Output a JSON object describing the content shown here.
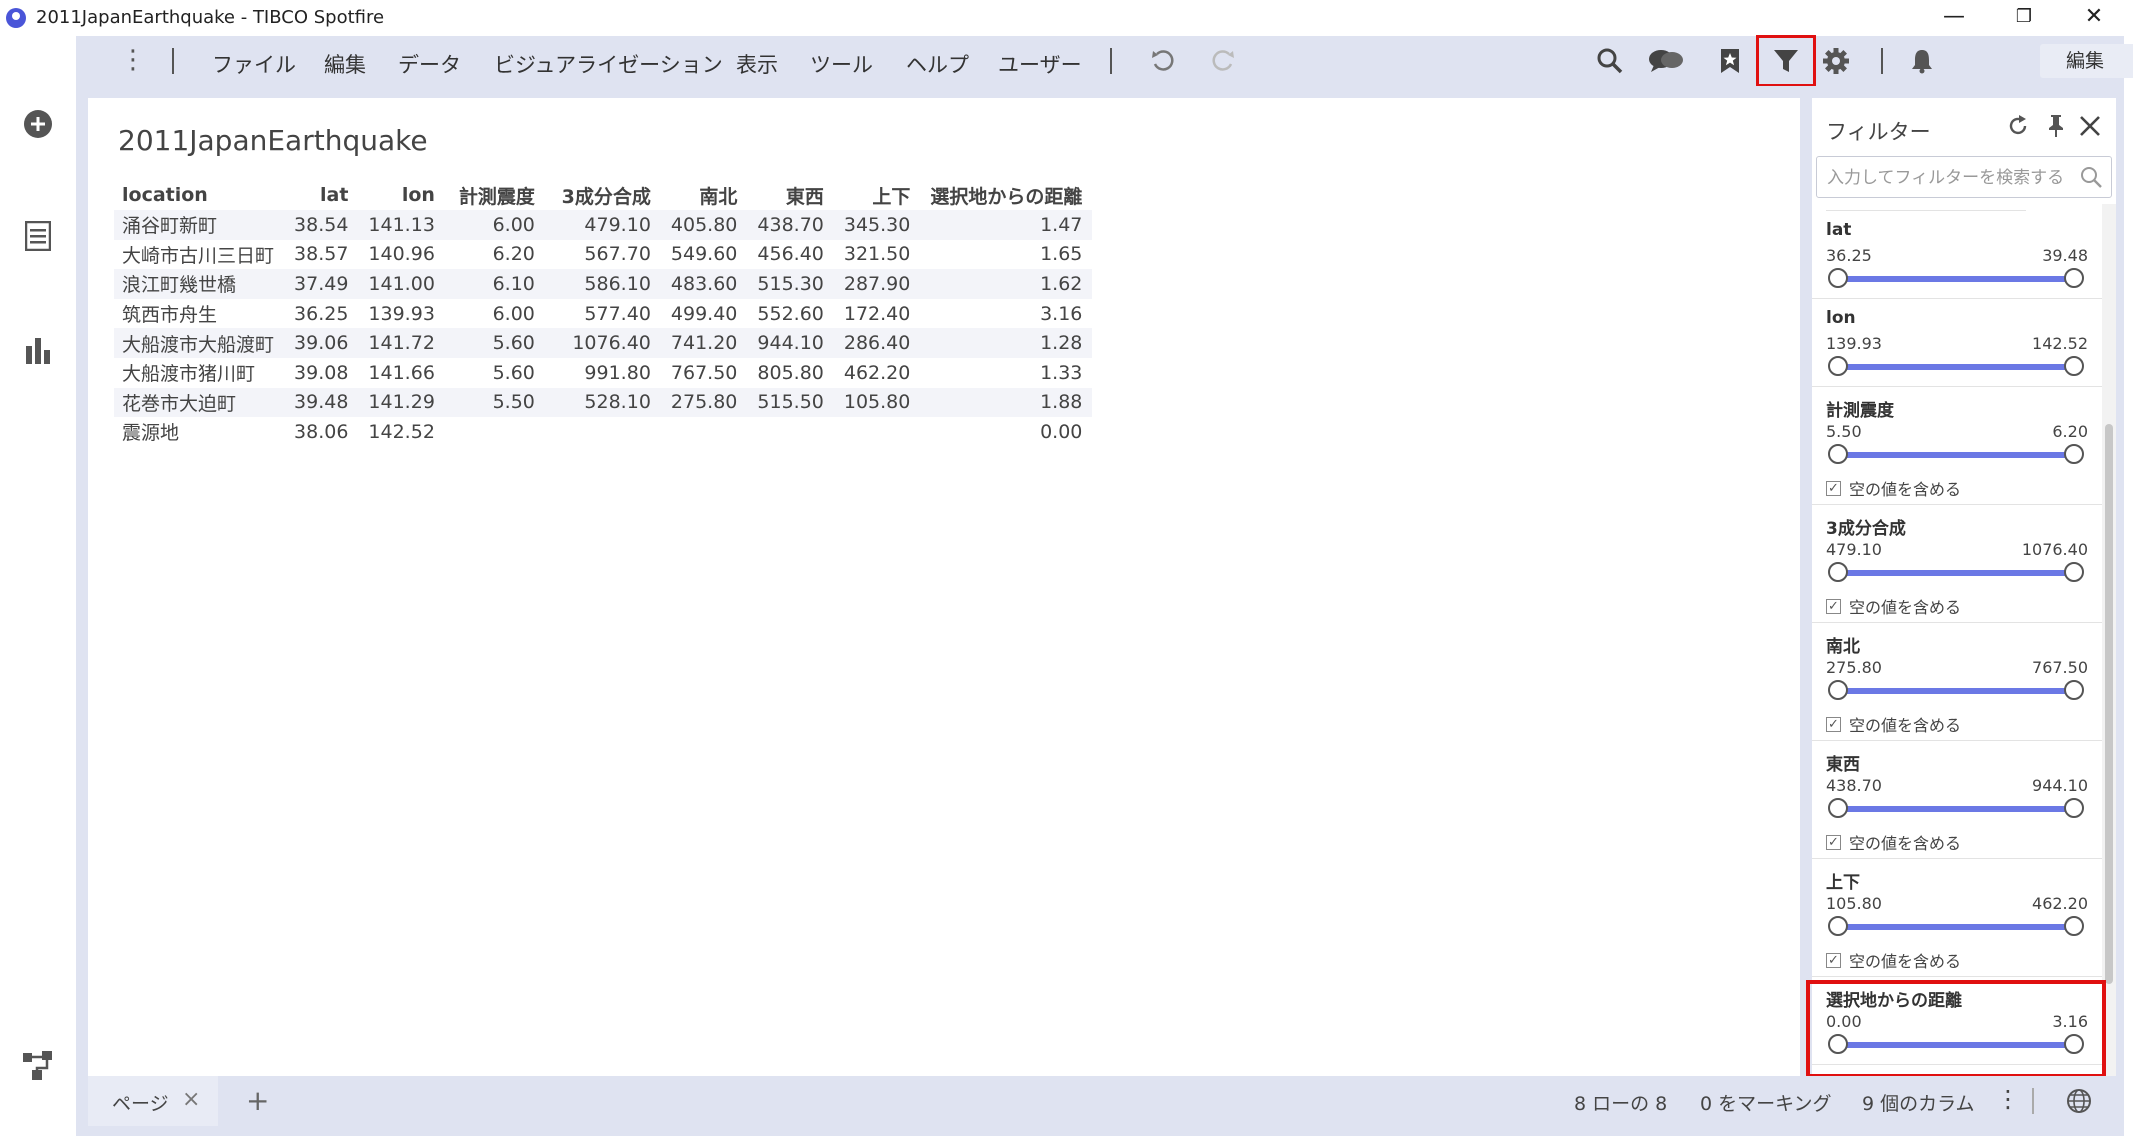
{
  "window": {
    "title": "2011JapanEarthquake - TIBCO Spotfire",
    "minimize": "—",
    "maximize": "❐",
    "close": "✕"
  },
  "menu": {
    "items": [
      "ファイル",
      "編集",
      "データ",
      "ビジュアライゼーション",
      "表示",
      "ツール",
      "ヘルプ",
      "ユーザー"
    ],
    "mode": "編集"
  },
  "visualization": {
    "title": "2011JapanEarthquake",
    "columns": [
      "location",
      "lat",
      "lon",
      "計測震度",
      "3成分合成",
      "南北",
      "東西",
      "上下",
      "選択地からの距離"
    ],
    "rows": [
      [
        "涌谷町新町",
        "38.54",
        "141.13",
        "6.00",
        "479.10",
        "405.80",
        "438.70",
        "345.30",
        "1.47"
      ],
      [
        "大崎市古川三日町",
        "38.57",
        "140.96",
        "6.20",
        "567.70",
        "549.60",
        "456.40",
        "321.50",
        "1.65"
      ],
      [
        "浪江町幾世橋",
        "37.49",
        "141.00",
        "6.10",
        "586.10",
        "483.60",
        "515.30",
        "287.90",
        "1.62"
      ],
      [
        "筑西市舟生",
        "36.25",
        "139.93",
        "6.00",
        "577.40",
        "499.40",
        "552.60",
        "172.40",
        "3.16"
      ],
      [
        "大船渡市大船渡町",
        "39.06",
        "141.72",
        "5.60",
        "1076.40",
        "741.20",
        "944.10",
        "286.40",
        "1.28"
      ],
      [
        "大船渡市猪川町",
        "39.08",
        "141.66",
        "5.60",
        "991.80",
        "767.50",
        "805.80",
        "462.20",
        "1.33"
      ],
      [
        "花巻市大迫町",
        "39.48",
        "141.29",
        "5.50",
        "528.10",
        "275.80",
        "515.50",
        "105.80",
        "1.88"
      ],
      [
        "震源地",
        "38.06",
        "142.52",
        "",
        "",
        "",
        "",
        "",
        "0.00"
      ]
    ]
  },
  "filter_panel": {
    "title": "フィルター",
    "search_placeholder": "入力してフィルターを検索する",
    "include_empty_label": "空の値を含める",
    "filters": [
      {
        "name": "lat",
        "min": "36.25",
        "max": "39.48",
        "has_empty": false
      },
      {
        "name": "lon",
        "min": "139.93",
        "max": "142.52",
        "has_empty": false
      },
      {
        "name": "計測震度",
        "min": "5.50",
        "max": "6.20",
        "has_empty": true
      },
      {
        "name": "3成分合成",
        "min": "479.10",
        "max": "1076.40",
        "has_empty": true
      },
      {
        "name": "南北",
        "min": "275.80",
        "max": "767.50",
        "has_empty": true
      },
      {
        "name": "東西",
        "min": "438.70",
        "max": "944.10",
        "has_empty": true
      },
      {
        "name": "上下",
        "min": "105.80",
        "max": "462.20",
        "has_empty": true
      },
      {
        "name": "選択地からの距離",
        "min": "0.00",
        "max": "3.16",
        "has_empty": false
      }
    ]
  },
  "bottom": {
    "page_tab": "ページ",
    "add": "+",
    "rows_status": "8 ローの 8",
    "marked_status": "0 をマーキング",
    "columns_status": "9 個のカラム"
  }
}
